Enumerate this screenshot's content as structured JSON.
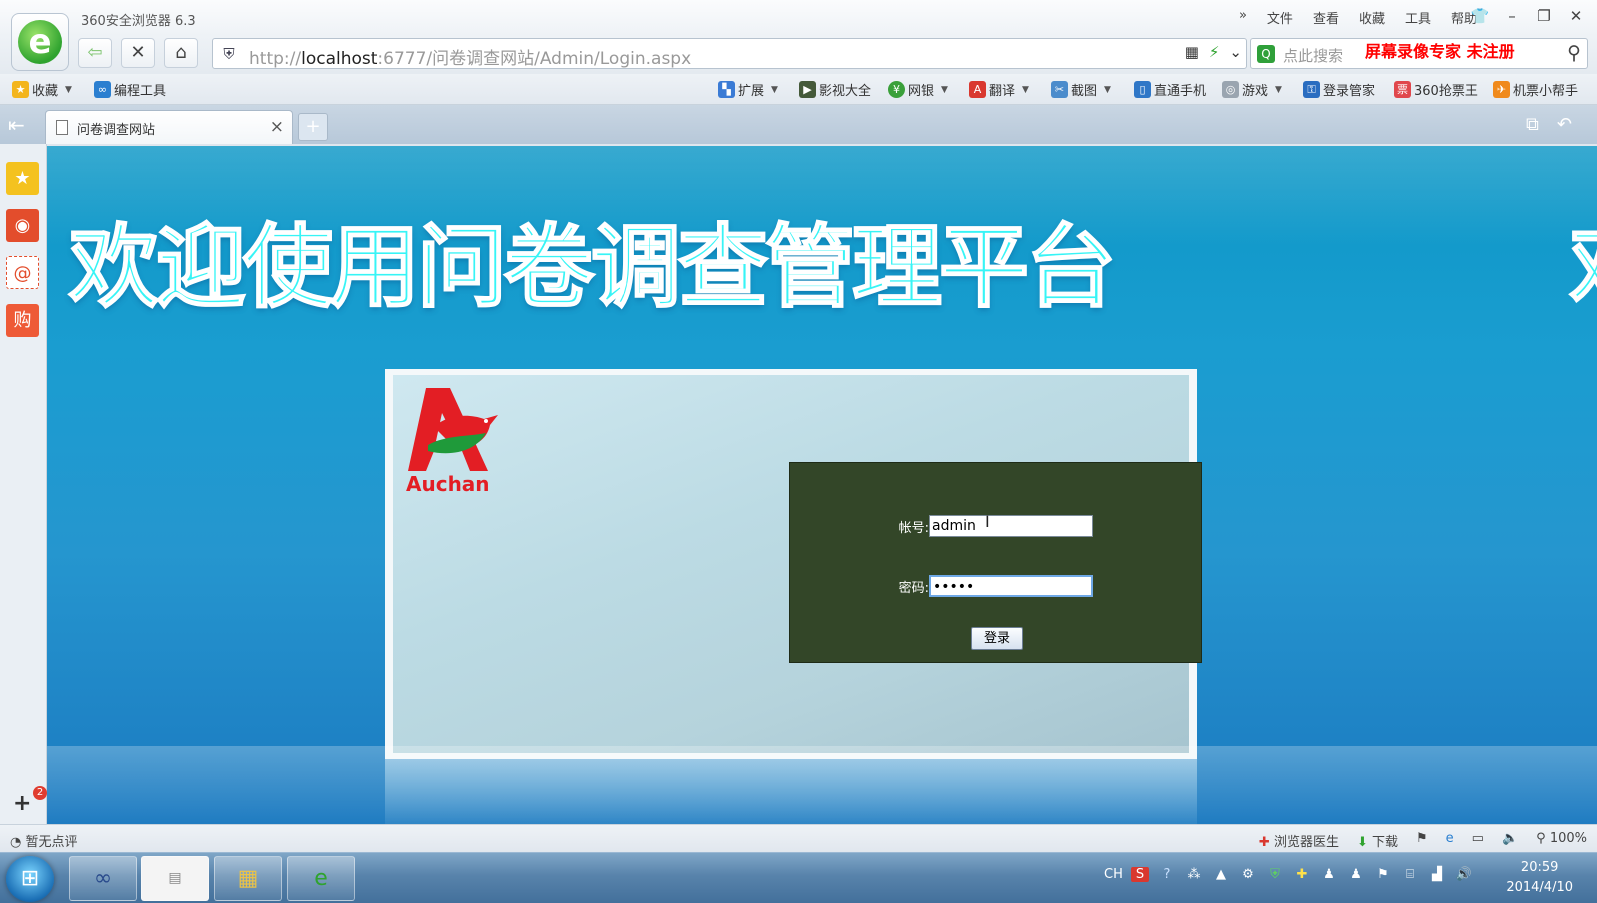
{
  "browser": {
    "title": "360安全浏览器 6.3",
    "menus": [
      "»",
      "文件",
      "查看",
      "收藏",
      "工具",
      "帮助"
    ],
    "url_prefix": "http://",
    "url_host": "localhost",
    "url_rest": ":6777/问卷调查网站/Admin/Login.aspx",
    "search_placeholder": "点此搜索",
    "watermark": "屏幕录像专家  未注册"
  },
  "bookmarks": {
    "left": [
      {
        "label": "收藏",
        "icon": "star-icon"
      },
      {
        "label": "编程工具",
        "icon": "link-icon"
      }
    ],
    "right": [
      {
        "label": "扩展",
        "icon": "extension-icon"
      },
      {
        "label": "影视大全",
        "icon": "video-icon"
      },
      {
        "label": "网银",
        "icon": "bank-icon"
      },
      {
        "label": "翻译",
        "icon": "translate-icon"
      },
      {
        "label": "截图",
        "icon": "screenshot-icon"
      },
      {
        "label": "直通手机",
        "icon": "phone-icon"
      },
      {
        "label": "游戏",
        "icon": "game-icon"
      },
      {
        "label": "登录管家",
        "icon": "key-icon"
      },
      {
        "label": "360抢票王",
        "icon": "ticket-icon"
      },
      {
        "label": "机票小帮手",
        "icon": "plane-icon"
      }
    ]
  },
  "tab": {
    "label": "问卷调查网站"
  },
  "page": {
    "banner": "欢迎使用问卷调查管理平台",
    "banner_repeat": "欢",
    "logo_text": "Auchan",
    "account_label": "帐号:",
    "account_value": "admin",
    "password_label": "密码:",
    "password_value": "•••••",
    "login_button": "登录"
  },
  "statusbar": {
    "left": "暂无点评",
    "doctor": "浏览器医生",
    "download": "下载",
    "zoom": "100%"
  },
  "taskbar": {
    "lang": "CH",
    "time": "20:59",
    "date": "2014/4/10"
  },
  "sidebar": {
    "badge": "2"
  }
}
